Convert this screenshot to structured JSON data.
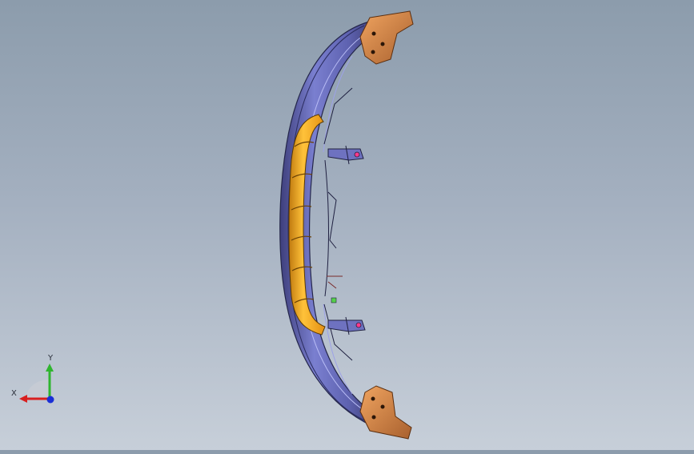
{
  "triad": {
    "x_label": "X",
    "y_label": "Y",
    "colors": {
      "x_axis": "#d81f1f",
      "y_axis": "#2fb52f",
      "z_axis": "#1a2fd6"
    }
  },
  "model": {
    "part": "front-bumper",
    "colors": {
      "bumper": "#6f76c4",
      "bumper_dark": "#3d3f7a",
      "grille_insert": "#f6a81d",
      "end_brackets": "#d9894a"
    }
  },
  "colors": {
    "background_top": "#8c9cac",
    "background_bottom": "#c7cfd9"
  }
}
